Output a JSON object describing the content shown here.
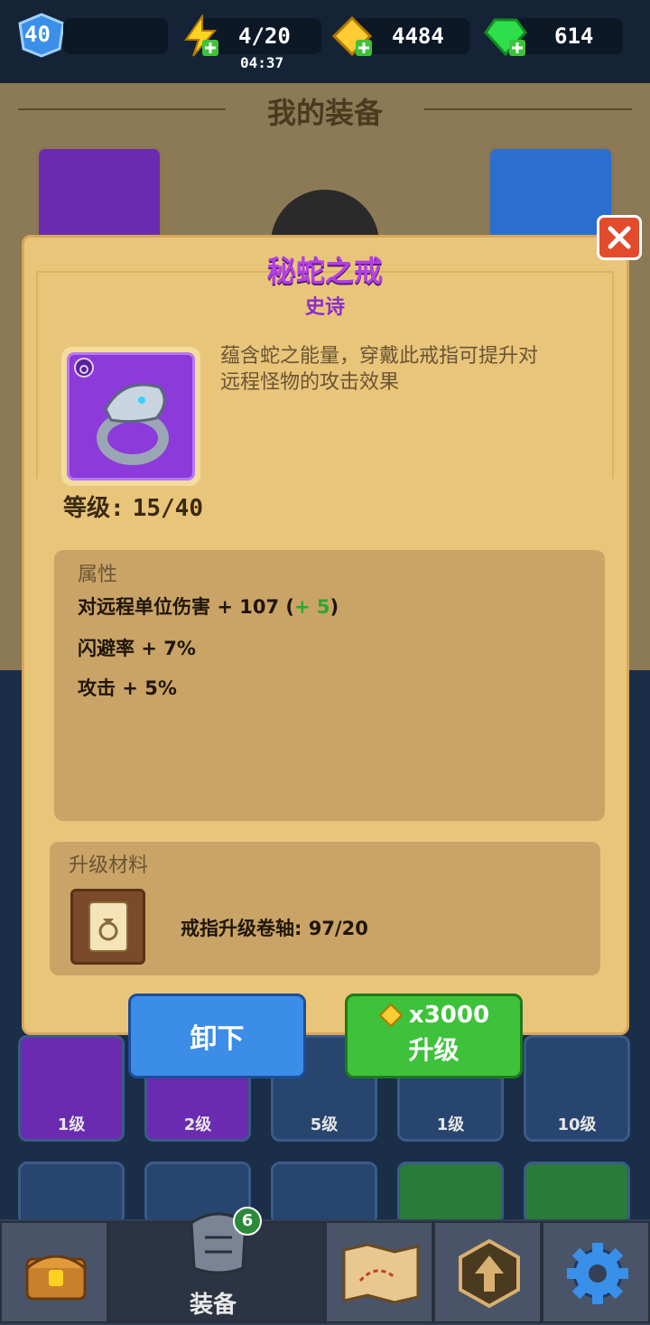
{
  "topbar": {
    "level": "40",
    "energy": "4/20",
    "energy_timer": "04:37",
    "gold": "4484",
    "gems": "614"
  },
  "screen": {
    "title": "我的装备"
  },
  "item": {
    "name": "秘蛇之戒",
    "rarity": "史诗",
    "description_line1": "蕴含蛇之能量，穿戴此戒指可提升对",
    "description_line2": "远程怪物的攻击效果",
    "level_label": "等级:",
    "level_value": "15/40"
  },
  "attributes": {
    "title": "属性",
    "rows": [
      {
        "name": "对远程单位伤害",
        "value": "+ 107 (",
        "bonus": "+ 5",
        "close": ")"
      },
      {
        "name": "闪避率",
        "value": "+ 7%"
      },
      {
        "name": "攻击",
        "value": "+ 5%"
      }
    ]
  },
  "materials": {
    "title": "升级材料",
    "item_text": "戒指升级卷轴: 97/20"
  },
  "buttons": {
    "unequip": "卸下",
    "upgrade_cost": "x3000",
    "upgrade_label": "升级"
  },
  "inventory_row1_labels": [
    "1级",
    "2级",
    "5级",
    "1级",
    "10级"
  ],
  "nav": {
    "equipment_label": "装备",
    "equipment_badge": "6"
  },
  "colors": {
    "epic_purple": "#b340e5",
    "upgrade_green": "#3ec23b",
    "unequip_blue": "#3b8de8",
    "close_red": "#e24b2c"
  }
}
